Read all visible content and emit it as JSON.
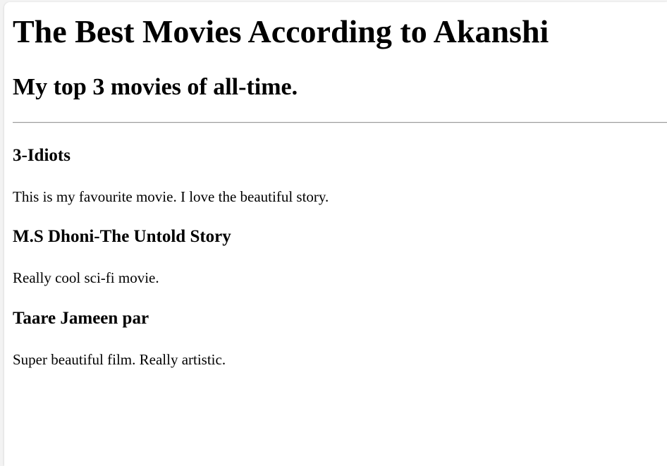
{
  "header": {
    "title": "The Best Movies According to Akanshi",
    "subtitle": "My top 3 movies of all-time."
  },
  "movies": [
    {
      "title": "3-Idiots",
      "description": "This is my favourite movie. I love the beautiful story."
    },
    {
      "title": "M.S Dhoni-The Untold Story",
      "description": "Really cool sci-fi movie."
    },
    {
      "title": "Taare Jameen par",
      "description": "Super beautiful film. Really artistic."
    }
  ]
}
